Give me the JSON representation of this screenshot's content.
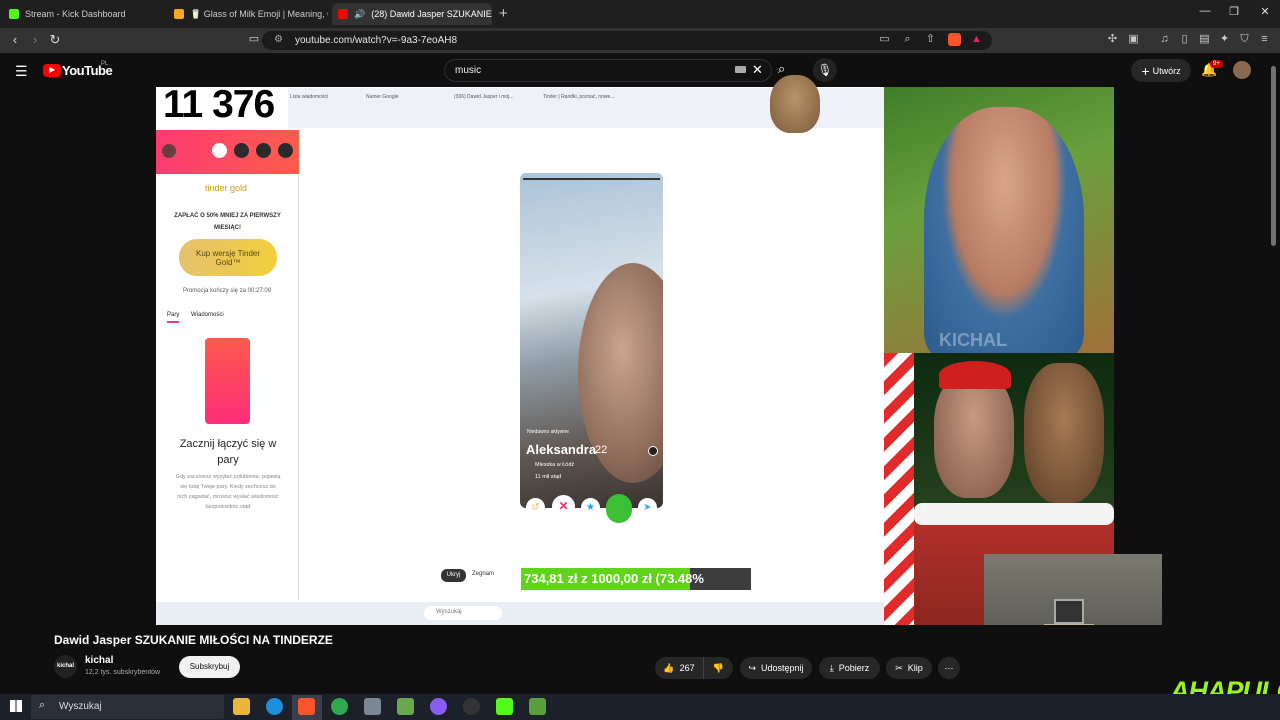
{
  "browser": {
    "tabs": [
      {
        "title": "Stream - Kick Dashboard",
        "active": false,
        "color": "#53fc18"
      },
      {
        "title": "🥛 Glass of Milk Emoji | Meaning, Co",
        "active": false,
        "color": "#f5a623"
      },
      {
        "title": "(28) Dawid Jasper SZUKANIE",
        "active": true,
        "color": "#ff0000"
      }
    ],
    "new_tab_icon": "plus-icon",
    "url": "youtube.com/watch?v=-9a3-7eoAH8"
  },
  "youtube": {
    "logo_text": "YouTube",
    "logo_region": "PL",
    "search_value": "music",
    "create_label": "Utwórz",
    "notif_badge": "9+"
  },
  "video": {
    "counter": "11 376",
    "inner_tabs": [
      "Lista wiadomości",
      "Numer Google",
      "(306) Dawid Jasper i mój...",
      "Tinder | Randki, poznać, nowe..."
    ],
    "tinder": {
      "brand": "tinder gold",
      "promo_line": "ZAPŁAĆ O 50% MNIEJ ZA PIERWSZY MIESIĄC!",
      "buy_button": "Kup wersję Tinder Gold™",
      "promo_timer": "Promocja kończy się za 00:27:09",
      "tab_pary": "Pary",
      "tab_messages": "Wiadomości",
      "match_title": "Zacznij łączyć się w pary",
      "match_desc": "Gdy zaczniesz wysyłać polubienia, pojawią się tutaj Twoje pary. Kiedy zechcesz do nich zagadać, możesz wysłać wiadomość bezpośrednio stąd",
      "profile_status": "Niedawno aktywne",
      "profile_name": "Aleksandra",
      "profile_age": "22",
      "profile_city": "Mieszka w Łódź",
      "profile_distance": "11 mil stąd",
      "btn_hide": "Ukryj",
      "btn_skip": "Zegnam"
    },
    "donation_text": "734,81 zł  z  1000,00 zł  (73.48%",
    "donation_progress": 0.7348,
    "inner_search": "Wyszukaj",
    "watermark_left": "KICHAL",
    "watermark_right": "AHAPULCO"
  },
  "meta": {
    "title": "Dawid Jasper SZUKANIE MIŁOŚCI NA TINDERZE",
    "channel_name": "kichal",
    "channel_avatar_text": "kichal",
    "subscribers": "12,2 tys. subskrybentów",
    "subscribe_label": "Subskrybuj",
    "likes": "267",
    "share_label": "Udostępnij",
    "download_label": "Pobierz",
    "clip_label": "Klip"
  },
  "windows": {
    "search_placeholder": "Wyszukaj"
  }
}
